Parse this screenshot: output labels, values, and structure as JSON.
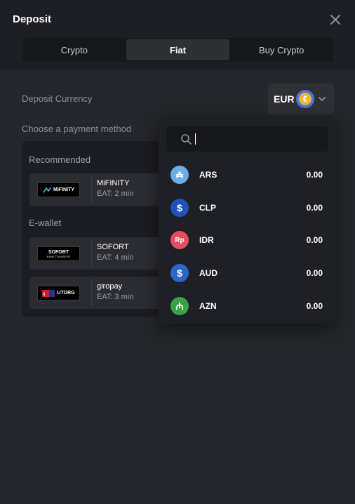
{
  "window": {
    "title": "Deposit"
  },
  "tabs": [
    {
      "label": "Crypto"
    },
    {
      "label": "Fiat"
    },
    {
      "label": "Buy Crypto"
    }
  ],
  "deposit_currency": {
    "label": "Deposit Currency",
    "selected_code": "EUR",
    "selected_symbol": "€"
  },
  "payment_methods": {
    "label": "Choose a payment method",
    "sections": [
      {
        "title": "Recommended",
        "items": [
          {
            "logo_text": "MiFINITY",
            "name": "MiFINITY",
            "eat": "EAT: 2 min"
          }
        ]
      },
      {
        "title": "E-wallet",
        "items": [
          {
            "logo_text": "SOFORT",
            "logo_sub": "BANK TRANSFER",
            "name": "SOFORT",
            "eat": "EAT: 4 min"
          },
          {
            "logo_text": "UTORG",
            "name": "giropay",
            "eat": "EAT: 3 min"
          }
        ]
      }
    ]
  },
  "currency_dropdown": {
    "search_placeholder": "",
    "options": [
      {
        "code": "ARS",
        "symbol": "₳",
        "balance": "0.00",
        "color": "#6aaee8"
      },
      {
        "code": "CLP",
        "symbol": "$",
        "balance": "0.00",
        "color": "#1f53b7"
      },
      {
        "code": "IDR",
        "symbol": "Rp",
        "balance": "0.00",
        "color": "#e44c5f"
      },
      {
        "code": "AUD",
        "symbol": "$",
        "balance": "0.00",
        "color": "#2c66c9"
      },
      {
        "code": "AZN",
        "symbol": "₼",
        "balance": "0.00",
        "color": "#3aa342"
      }
    ]
  }
}
